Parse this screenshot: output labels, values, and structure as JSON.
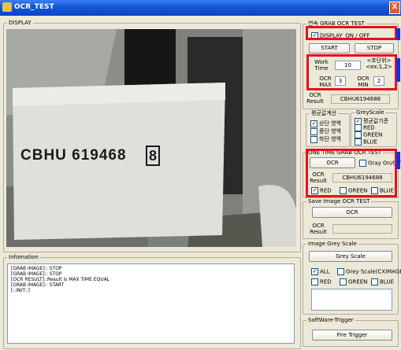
{
  "window": {
    "title": "OCR_TEST",
    "close_glyph": "X"
  },
  "display": {
    "legend": "DISPLAY",
    "ocr_text": "CBHU 619468",
    "check_digit": "8"
  },
  "information": {
    "legend": "Infomation",
    "lines": [
      "[GRAB IMAGE]:: STOP",
      "[GRAB IMAGE]:: STOP",
      "[OCR RESULT]::Result is MAX TIME EQUAL",
      "[GRAB IMAGE]:: START",
      "[::INIT::]"
    ]
  },
  "continuous": {
    "legend": "연속 GRAB OCR TEST",
    "display_toggle": {
      "label": "DISPLAY_ON / OFF",
      "checked": true
    },
    "start_label": "START",
    "stop_label": "STOP",
    "work_time_label": "Work Time",
    "work_time_value": "10",
    "work_time_hint": "<초단위> <ex:1,2>",
    "ocr_max_label": "OCR MAX",
    "ocr_max_value": "3",
    "ocr_min_label": "OCR MIN",
    "ocr_min_value": "2",
    "result_label": "OCR Result",
    "result_value": "CBHU6194688"
  },
  "avg_calc": {
    "legend": "평균값계산",
    "items": [
      {
        "label": "상단 영역",
        "checked": true
      },
      {
        "label": "중단 영역",
        "checked": false
      },
      {
        "label": "하단 영역",
        "checked": false
      }
    ]
  },
  "greyscale_options": {
    "legend": "GreyScale",
    "items": [
      {
        "label": "평균값기준",
        "checked": true
      },
      {
        "label": "RED",
        "checked": false
      },
      {
        "label": "GREEN",
        "checked": false
      },
      {
        "label": "BLUE",
        "checked": false
      }
    ]
  },
  "one_time": {
    "legend": "ONE TIME GRAB OCR TEST",
    "ocr_label": "OCR",
    "gray_toggle": {
      "label": "Gray On/Off",
      "checked": false
    },
    "result_label": "OCR Result",
    "result_value": "CBHU6194688",
    "channels": [
      {
        "label": "RED",
        "checked": true
      },
      {
        "label": "GREEN",
        "checked": false
      },
      {
        "label": "BLUE",
        "checked": false
      }
    ]
  },
  "save_image": {
    "legend": "Save Image OCR TEST",
    "ocr_label": "OCR",
    "result_label": "OCR Result",
    "result_value": ""
  },
  "image_grey": {
    "legend": "Image Grey Scale",
    "button_label": "Grey Scale",
    "all": {
      "label": "ALL",
      "checked": true
    },
    "cximage": {
      "label": "Grey Scale(CXIMAGE)",
      "checked": false
    },
    "channels": [
      {
        "label": "RED",
        "checked": false
      },
      {
        "label": "GREEN",
        "checked": false
      },
      {
        "label": "BLUE",
        "checked": false
      }
    ]
  },
  "software_trigger": {
    "legend": "SoftWare-Trigger",
    "button_label": "Fire Trigger"
  },
  "colors": {
    "highlight_red": "#e8101a",
    "marker_blue": "#1e2ad8",
    "titlebar": "#0a46c6"
  }
}
